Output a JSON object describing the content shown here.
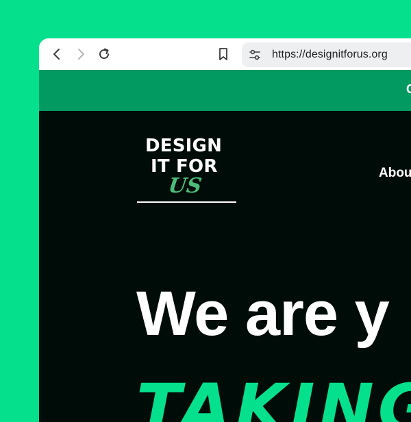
{
  "browser": {
    "url": "https://designitforus.org",
    "icons": [
      "back-icon",
      "forward-icon",
      "reload-icon",
      "bookmark-icon",
      "site-settings-icon"
    ]
  },
  "banner": {
    "text": "C"
  },
  "site": {
    "logo": {
      "line1": "DESIGN",
      "line2": "IT FOR",
      "line3": "US"
    },
    "nav": {
      "about": "Abou"
    },
    "hero": {
      "headline": "We are y",
      "subline": "TAKING"
    }
  },
  "colors": {
    "background": "#05e08d",
    "banner": "#039a62",
    "site_background": "#000c08",
    "accent": "#4bbd7a"
  }
}
